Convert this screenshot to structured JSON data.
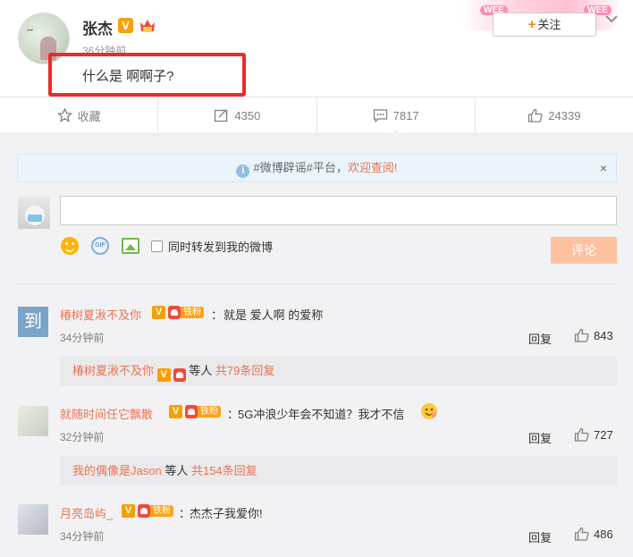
{
  "post": {
    "author": "张杰",
    "vip_badge": "V",
    "time": "36分钟前",
    "text": "什么是 啊啊子?",
    "follow_label": "关注",
    "follow_plus": "+",
    "banner_tags": [
      "WEE",
      "WEE"
    ]
  },
  "actions": {
    "favorite": "收藏",
    "repost": "4350",
    "comment": "7817",
    "like": "24339"
  },
  "notice": {
    "icon": "i",
    "text": "#微博辟谣#平台，",
    "link": "欢迎查阅!",
    "close": "×"
  },
  "composer": {
    "gif_label": "GIF",
    "repost_check_label": "同时转发到我的微博",
    "submit_label": "评论"
  },
  "fan_label": "铁粉",
  "comments": [
    {
      "name": "椿树夏湫不及你",
      "text": "就是  爱人啊  的爱称",
      "time": "34分钟前",
      "reply": "回复",
      "likes": "843",
      "sub_user": "椿树夏湫不及你",
      "sub_text": "等人",
      "sub_count": "共79条回复",
      "avatar_char": "到"
    },
    {
      "name": "就随时间任它飘散",
      "text": "5G冲浪少年会不知道？我才不信",
      "time": "32分钟前",
      "reply": "回复",
      "likes": "727",
      "sub_user": "我的偶像是Jason",
      "sub_text": "等人",
      "sub_count": "共154条回复"
    },
    {
      "name": "月亮岛屿_",
      "text": "杰杰子我爱你!",
      "time": "34分钟前",
      "reply": "回复",
      "likes": "486"
    }
  ]
}
